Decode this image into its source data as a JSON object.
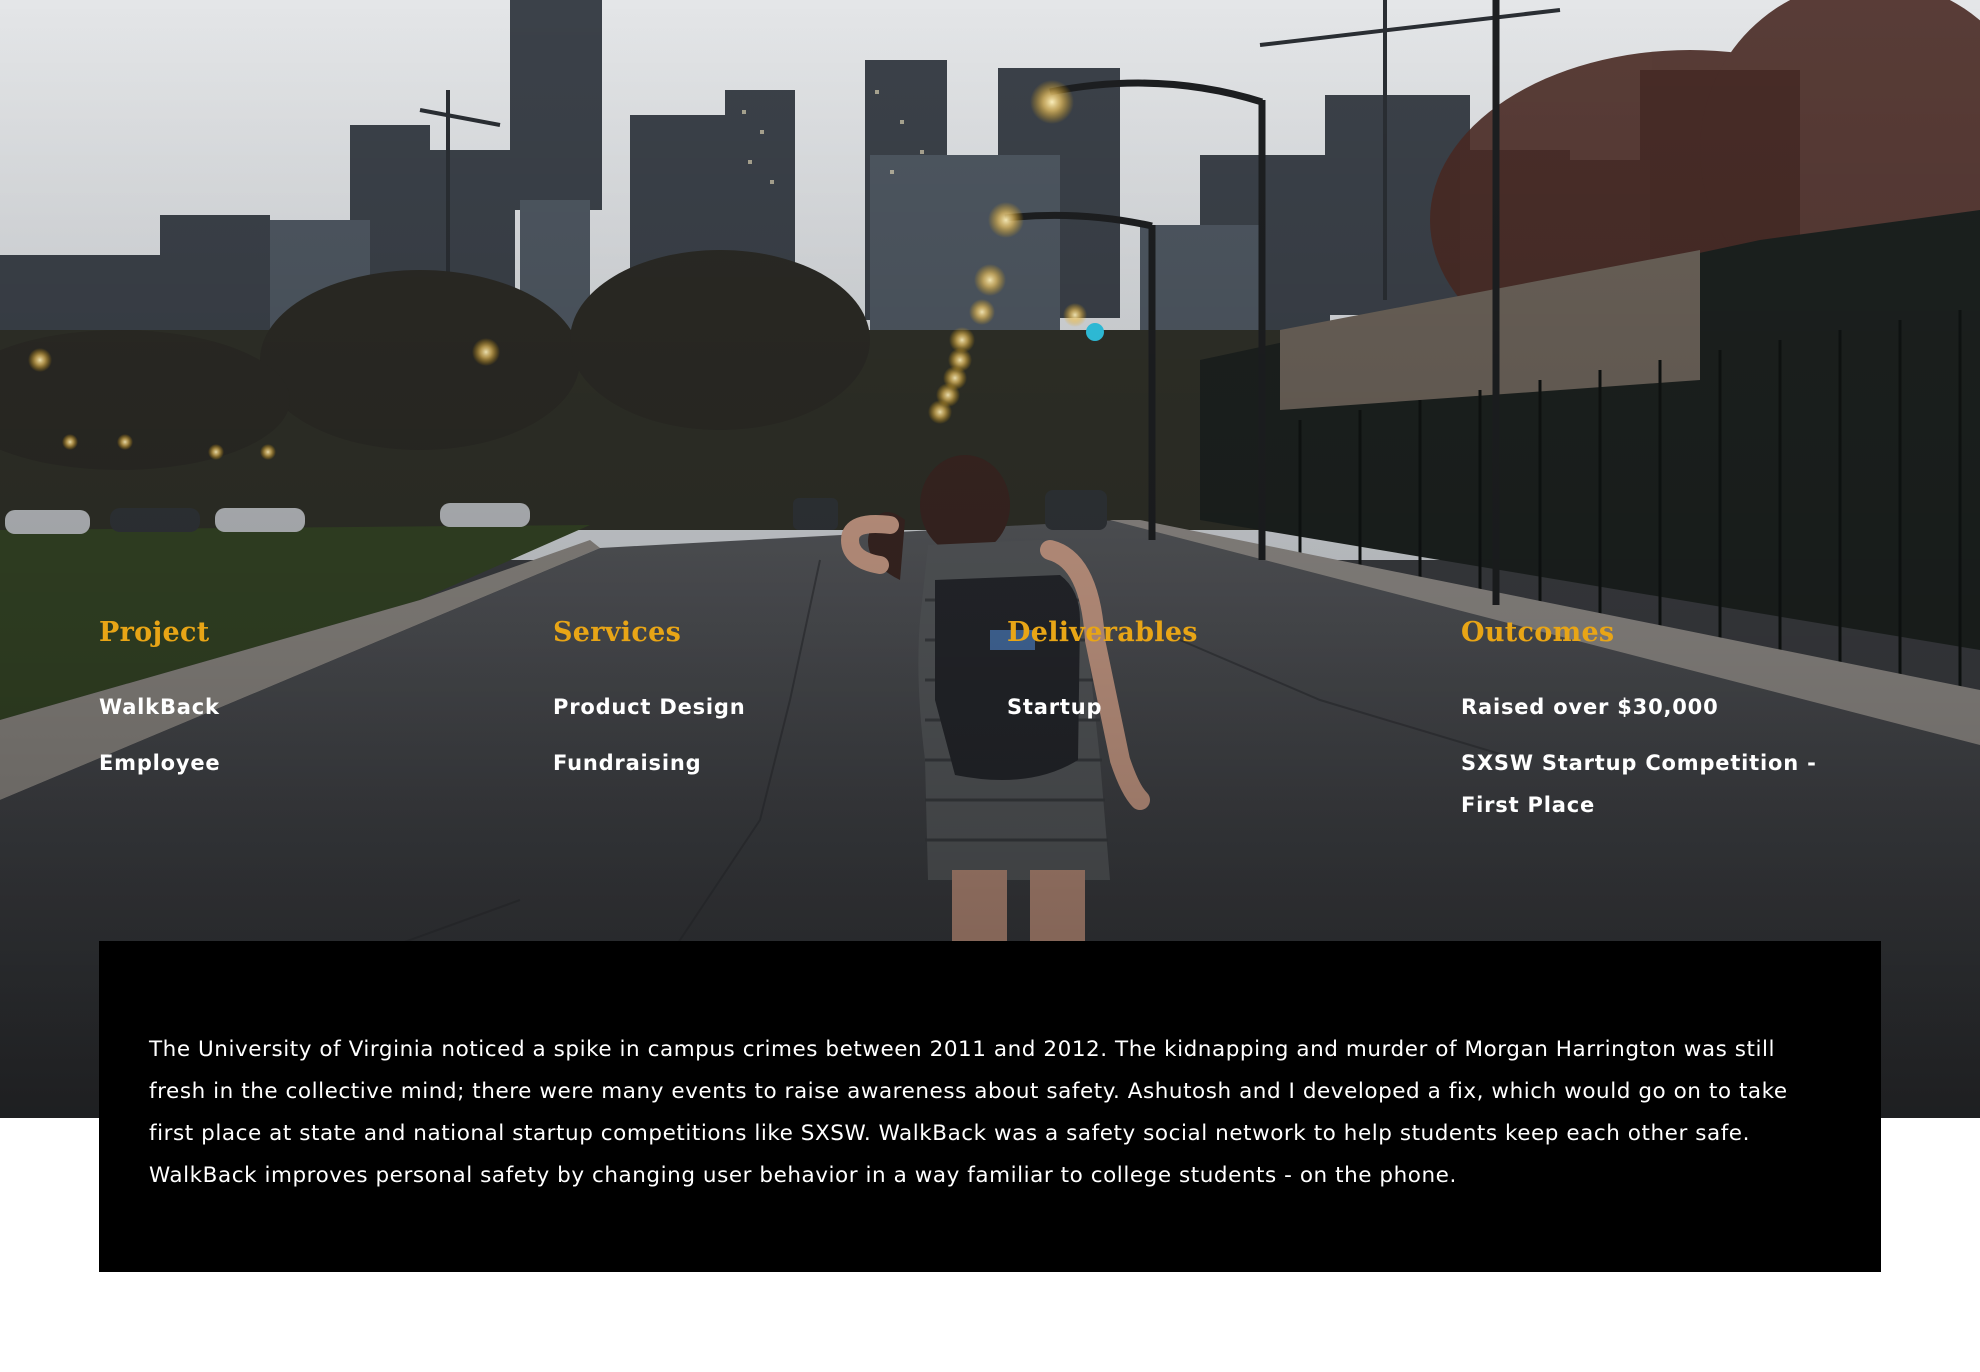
{
  "hero": {
    "image_alt": "Woman walking down a city street toward a downtown skyline at dusk"
  },
  "columns": [
    {
      "heading": "Project",
      "items": [
        "WalkBack",
        "Employee"
      ]
    },
    {
      "heading": "Services",
      "items": [
        "Product Design",
        "Fundraising"
      ]
    },
    {
      "heading": "Deliverables",
      "items": [
        "Startup"
      ]
    },
    {
      "heading": "Outcomes",
      "items": [
        "Raised over $30,000",
        "SXSW Startup Competition - First Place"
      ]
    }
  ],
  "description": "The University of Virginia noticed a spike in campus crimes between 2011 and 2012. The kidnapping and murder of Morgan Harrington was still fresh in the collective mind; there were many events to raise awareness about safety. Ashutosh and I developed a fix, which would go on to take first place at state and national startup competitions like SXSW. WalkBack was a safety social network to help students keep each other safe. WalkBack improves personal safety by changing user behavior in a way familiar to college students - on the phone.",
  "colors": {
    "heading_accent": "#e8a516",
    "text": "#ffffff",
    "description_bg": "#000000"
  }
}
